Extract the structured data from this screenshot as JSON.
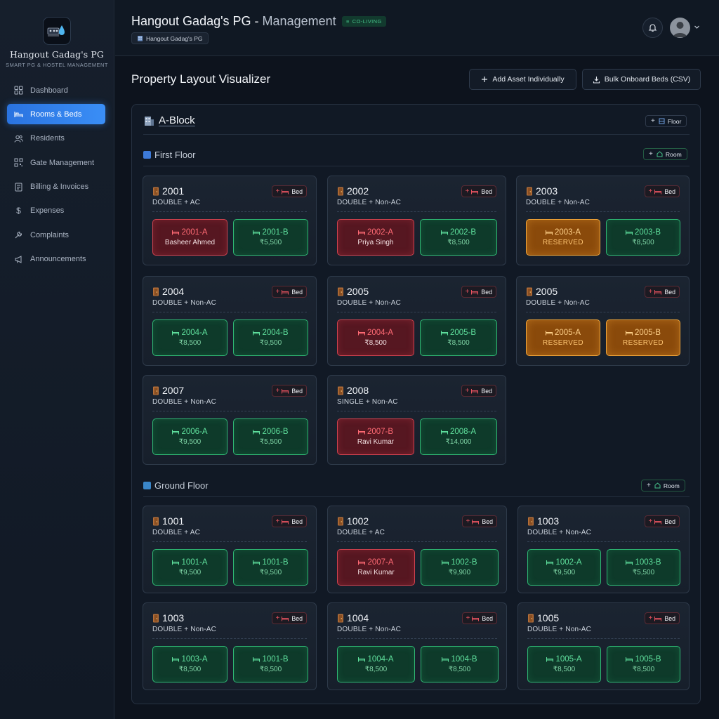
{
  "sidebar": {
    "brand_name": "Hangout Gadag's PG",
    "brand_tagline": "SMART PG & HOSTEL MANAGEMENT",
    "items": [
      {
        "label": "Dashboard",
        "icon": "grid-icon"
      },
      {
        "label": "Rooms & Beds",
        "icon": "bed-icon",
        "active": true
      },
      {
        "label": "Residents",
        "icon": "users-icon"
      },
      {
        "label": "Gate Management",
        "icon": "qr-icon"
      },
      {
        "label": "Billing & Invoices",
        "icon": "invoice-icon"
      },
      {
        "label": "Expenses",
        "icon": "dollar-icon"
      },
      {
        "label": "Complaints",
        "icon": "wrench-icon"
      },
      {
        "label": "Announcements",
        "icon": "megaphone-icon"
      }
    ]
  },
  "header": {
    "title_main": "Hangout Gadag's PG - ",
    "title_muted": "Management",
    "badge": "CO-LIVING",
    "breadcrumb": "Hangout Gadag's PG"
  },
  "main": {
    "title": "Property Layout Visualizer",
    "add_asset_label": "Add Asset Individually",
    "bulk_label": "Bulk Onboard Beds (CSV)",
    "block_name": "A-Block",
    "floor_button": "Floor",
    "room_button": "Room",
    "bed_button": "Bed"
  },
  "floors": [
    {
      "name": "First Floor",
      "rooms": [
        {
          "number": "2001",
          "type": "DOUBLE + AC",
          "beds": [
            {
              "id": "2001-A",
              "status": "occupied",
              "info": "Basheer Ahmed"
            },
            {
              "id": "2001-B",
              "status": "vacant",
              "info": "₹5,500"
            }
          ]
        },
        {
          "number": "2002",
          "type": "DOUBLE + Non-AC",
          "beds": [
            {
              "id": "2002-A",
              "status": "occupied",
              "info": "Priya Singh"
            },
            {
              "id": "2002-B",
              "status": "vacant",
              "info": "₹8,500"
            }
          ]
        },
        {
          "number": "2003",
          "type": "DOUBLE + Non-AC",
          "beds": [
            {
              "id": "2003-A",
              "status": "reserved",
              "info": "RESERVED"
            },
            {
              "id": "2003-B",
              "status": "vacant",
              "info": "₹8,500"
            }
          ]
        },
        {
          "number": "2004",
          "type": "DOUBLE + Non-AC",
          "beds": [
            {
              "id": "2004-A",
              "status": "vacant",
              "info": "₹8,500"
            },
            {
              "id": "2004-B",
              "status": "vacant",
              "info": "₹9,500"
            }
          ]
        },
        {
          "number": "2005",
          "type": "DOUBLE + Non-AC",
          "beds": [
            {
              "id": "2004-A",
              "status": "occupied",
              "info": "₹8,500"
            },
            {
              "id": "2005-B",
              "status": "vacant",
              "info": "₹8,500"
            }
          ]
        },
        {
          "number": "2005",
          "type": "DOUBLE + Non-AC",
          "beds": [
            {
              "id": "2005-A",
              "status": "reserved",
              "info": "RESERVED"
            },
            {
              "id": "2005-B",
              "status": "reserved",
              "info": "RESERVED"
            }
          ]
        },
        {
          "number": "2007",
          "type": "DOUBLE + Non-AC",
          "beds": [
            {
              "id": "2006-A",
              "status": "vacant",
              "info": "₹9,500"
            },
            {
              "id": "2006-B",
              "status": "vacant",
              "info": "₹5,500"
            }
          ]
        },
        {
          "number": "2008",
          "type": "SINGLE + Non-AC",
          "beds": [
            {
              "id": "2007-B",
              "status": "occupied",
              "info": "Ravi Kumar"
            },
            {
              "id": "2008-A",
              "status": "vacant",
              "info": "₹14,000"
            }
          ]
        }
      ]
    },
    {
      "name": "Ground Floor",
      "rooms": [
        {
          "number": "1001",
          "type": "DOUBLE + AC",
          "beds": [
            {
              "id": "1001-A",
              "status": "vacant",
              "info": "₹9,500"
            },
            {
              "id": "1001-B",
              "status": "vacant",
              "info": "₹9,500"
            }
          ]
        },
        {
          "number": "1002",
          "type": "DOUBLE + AC",
          "beds": [
            {
              "id": "2007-A",
              "status": "occupied",
              "info": "Ravi Kumar"
            },
            {
              "id": "1002-B",
              "status": "vacant",
              "info": "₹9,900"
            }
          ]
        },
        {
          "number": "1003",
          "type": "DOUBLE + Non-AC",
          "beds": [
            {
              "id": "1002-A",
              "status": "vacant",
              "info": "₹9,500"
            },
            {
              "id": "1003-B",
              "status": "vacant",
              "info": "₹5,500"
            }
          ]
        },
        {
          "number": "1003",
          "type": "DOUBLE + Non-AC",
          "beds": [
            {
              "id": "1003-A",
              "status": "vacant",
              "info": "₹8,500"
            },
            {
              "id": "1001-B",
              "status": "vacant",
              "info": "₹8,500"
            }
          ]
        },
        {
          "number": "1004",
          "type": "DOUBLE + Non-AC",
          "beds": [
            {
              "id": "1004-A",
              "status": "vacant",
              "info": "₹8,500"
            },
            {
              "id": "1004-B",
              "status": "vacant",
              "info": "₹8,500"
            }
          ]
        },
        {
          "number": "1005",
          "type": "DOUBLE + Non-AC",
          "beds": [
            {
              "id": "1005-A",
              "status": "vacant",
              "info": "₹8,500"
            },
            {
              "id": "1005-B",
              "status": "vacant",
              "info": "₹8,500"
            }
          ]
        }
      ]
    }
  ],
  "colors": {
    "accent": "#3a8ef6",
    "vacant": "#2fb874",
    "occupied": "#d0424f",
    "reserved": "#f0a53a"
  }
}
